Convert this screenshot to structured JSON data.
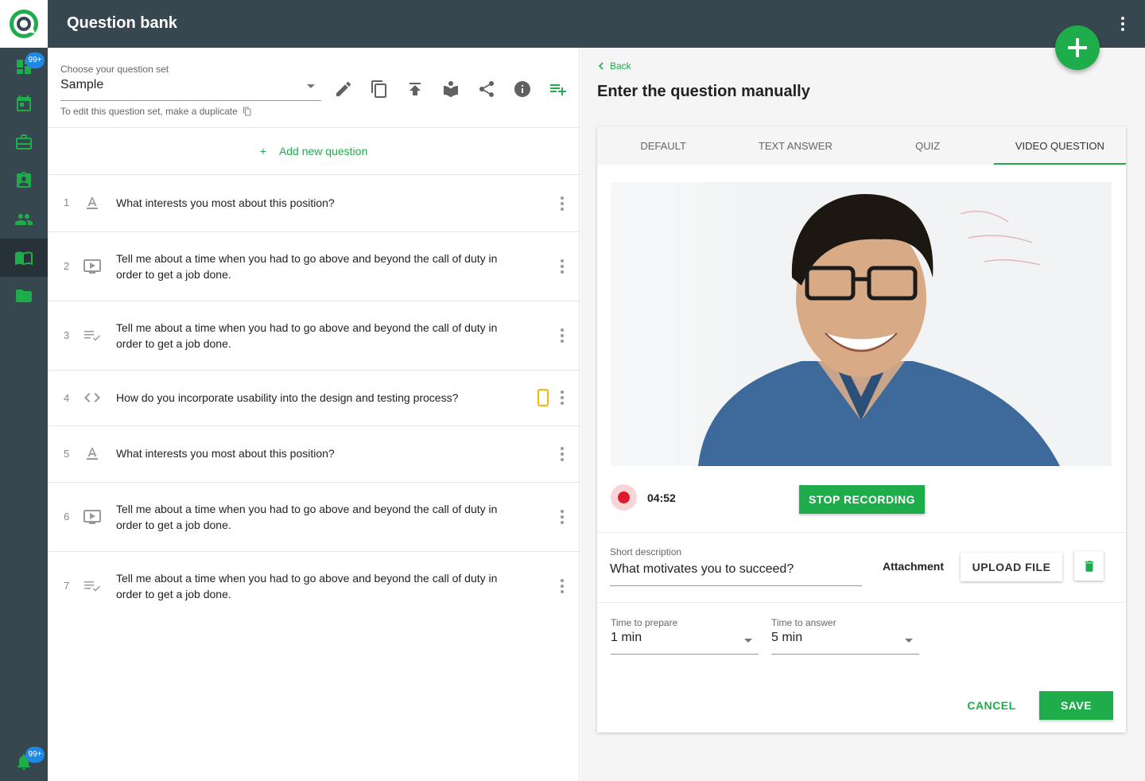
{
  "sidebar": {
    "top_badge": "99+",
    "bottom_badge": "99+",
    "items": [
      {
        "icon": "dashboard-icon"
      },
      {
        "icon": "calendar-icon"
      },
      {
        "icon": "briefcase-icon"
      },
      {
        "icon": "assignment-ind-icon"
      },
      {
        "icon": "people-icon"
      },
      {
        "icon": "book-icon"
      },
      {
        "icon": "folder-icon"
      }
    ]
  },
  "header": {
    "title": "Question bank"
  },
  "question_set": {
    "label": "Choose your question set",
    "value": "Sample",
    "hint": "To edit this question set, make a duplicate",
    "add_new": "Add new question"
  },
  "questions": [
    {
      "num": "1",
      "text": "What interests you most about this position?",
      "type": "text-answer-icon"
    },
    {
      "num": "2",
      "text": "Tell me about a time when you had to go above and beyond the call of duty in order to get a job done.",
      "type": "video-icon"
    },
    {
      "num": "3",
      "text": "Tell me about a time when you had to go above and beyond the call of duty in order to get a job done.",
      "type": "quiz-icon"
    },
    {
      "num": "4",
      "text": "How do you incorporate usability into the design and testing process?",
      "type": "code-icon"
    },
    {
      "num": "5",
      "text": "What interests you most about this position?",
      "type": "text-answer-icon"
    },
    {
      "num": "6",
      "text": "Tell me about a time when you had to go above and beyond the call of duty in order to get a job done.",
      "type": "video-icon"
    },
    {
      "num": "7",
      "text": "Tell me about a time when you had to go above and beyond the call of duty in order to get a job done.",
      "type": "quiz-icon"
    }
  ],
  "editor": {
    "back": "Back",
    "title": "Enter the question manually",
    "tabs": [
      "DEFAULT",
      "TEXT ANSWER",
      "QUIZ",
      "VIDEO QUESTION"
    ],
    "timer": "04:52",
    "stop_recording": "STOP RECORDING",
    "short_description_label": "Short description",
    "short_description_value": "What motivates you to succeed?",
    "attachment_label": "Attachment",
    "upload_file": "UPLOAD FILE",
    "prepare_label": "Time to prepare",
    "prepare_value": "1 min",
    "answer_label": "Time to answer",
    "answer_value": "5 min",
    "cancel": "CANCEL",
    "save": "SAVE"
  },
  "colors": {
    "accent": "#1fac4b",
    "sidebar": "#37474f",
    "badge": "#1e88e5",
    "record": "#e0192d",
    "mobile_flag": "#f5b800"
  }
}
